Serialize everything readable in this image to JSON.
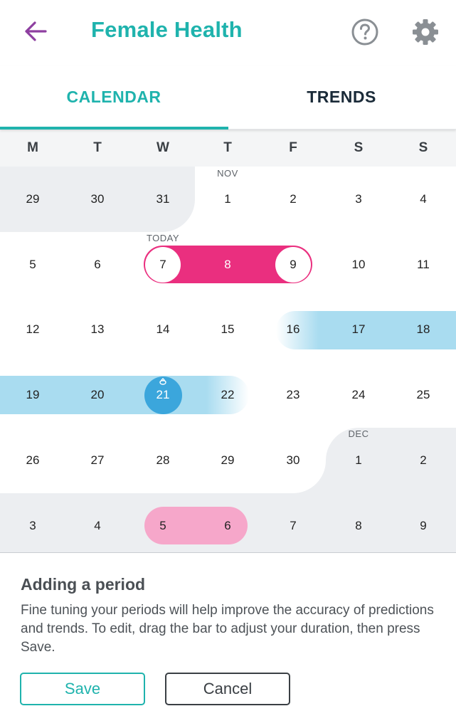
{
  "header": {
    "title": "Female Health",
    "back_icon": "arrow-left-icon",
    "help_icon": "help-circle-icon",
    "settings_icon": "gear-icon"
  },
  "tabs": [
    {
      "label": "CALENDAR",
      "active": true
    },
    {
      "label": "TRENDS",
      "active": false
    }
  ],
  "weekdays": [
    "M",
    "T",
    "W",
    "T",
    "F",
    "S",
    "S"
  ],
  "month_labels": {
    "nov": "NOV",
    "dec": "DEC",
    "today": "TODAY"
  },
  "weeks": [
    [
      "29",
      "30",
      "31",
      "1",
      "2",
      "3",
      "4"
    ],
    [
      "5",
      "6",
      "7",
      "8",
      "9",
      "10",
      "11"
    ],
    [
      "12",
      "13",
      "14",
      "15",
      "16",
      "17",
      "18"
    ],
    [
      "19",
      "20",
      "21",
      "22",
      "23",
      "24",
      "25"
    ],
    [
      "26",
      "27",
      "28",
      "29",
      "30",
      "1",
      "2"
    ],
    [
      "3",
      "4",
      "5",
      "6",
      "7",
      "8",
      "9"
    ]
  ],
  "panel": {
    "title": "Adding a period",
    "text": "Fine tuning your periods will help improve the accuracy of predictions and trends. To edit, drag the bar to adjust your duration, then press Save."
  },
  "buttons": {
    "save": "Save",
    "cancel": "Cancel"
  },
  "colors": {
    "accent": "#1fb3ad",
    "period": "#ea2f7f",
    "predicted_period": "#f6a7ca",
    "fertile_window": "#a9dcf0",
    "today": "#3ba6dc",
    "back_arrow": "#8e3fa0"
  }
}
